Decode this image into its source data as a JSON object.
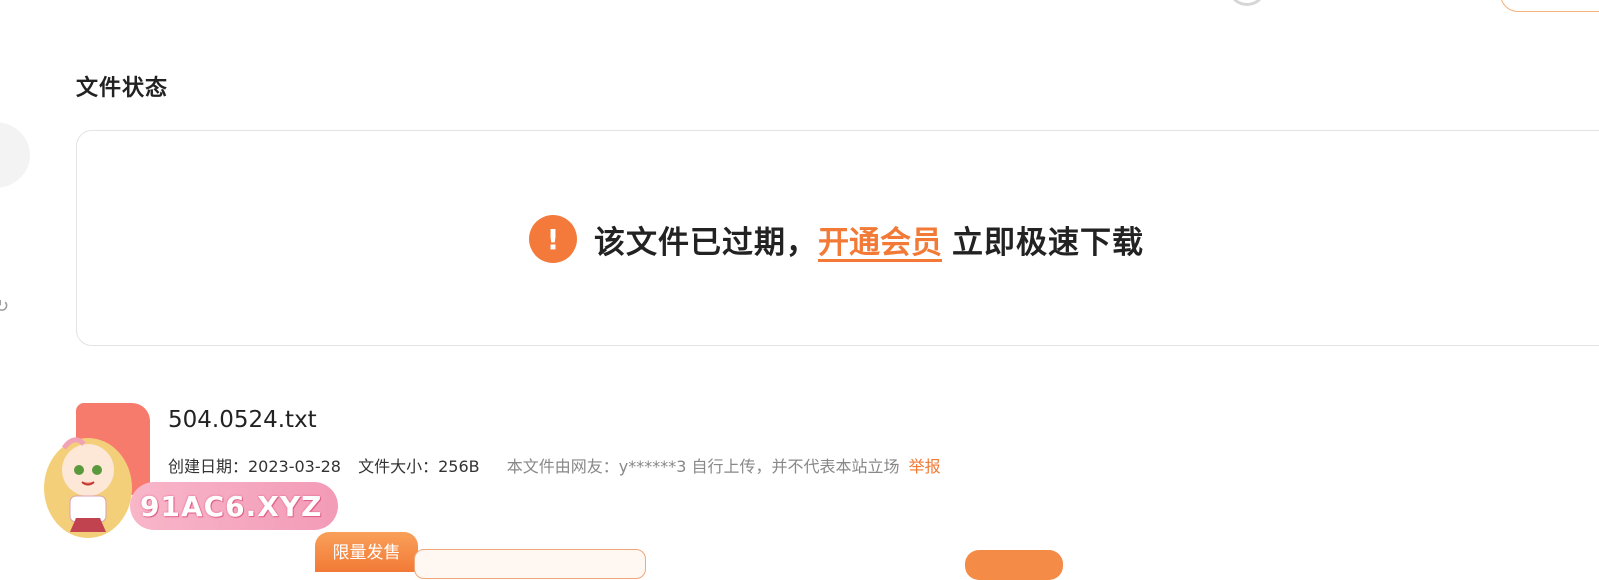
{
  "section": {
    "title": "文件状态"
  },
  "status": {
    "icon": "exclamation-icon",
    "icon_glyph": "!",
    "message": "该文件已过期，",
    "vip_link": "开通会员",
    "message_suffix": "立即极速下载",
    "accent_color": "#f27a36"
  },
  "file": {
    "name": "504.0524.txt",
    "created_label": "创建日期：2023-03-28",
    "size_label": "文件大小：256B",
    "uploader_note": "本文件由网友：y******3 自行上传，并不代表本站立场",
    "report_label": "举报"
  },
  "watermark": {
    "text": "91AC6.XYZ"
  },
  "promo": {
    "badge": "限量发售"
  }
}
